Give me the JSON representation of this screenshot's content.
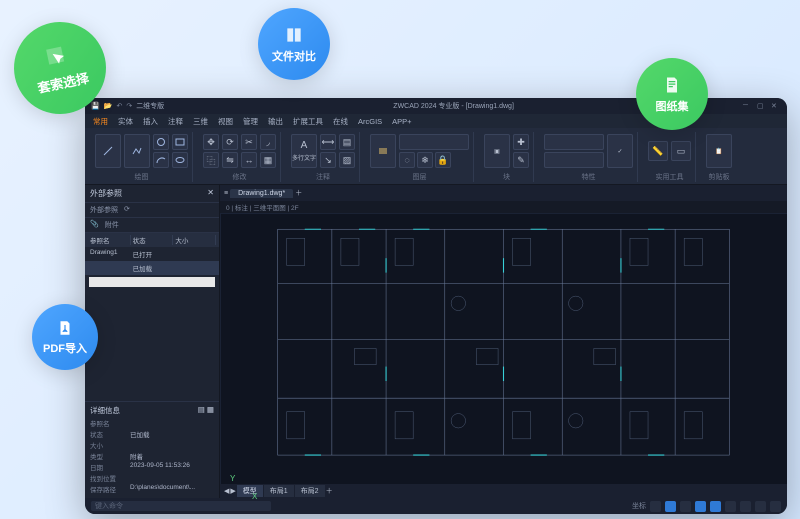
{
  "badges": {
    "lasso": "套索选择",
    "compare": "文件对比",
    "sheetset": "图纸集",
    "pdf": "PDF导入"
  },
  "titlebar": {
    "product": "二维专版",
    "title": "ZWCAD 2024 专业版 - [Drawing1.dwg]"
  },
  "menu": [
    "常用",
    "实体",
    "插入",
    "注释",
    "三维",
    "视图",
    "管理",
    "输出",
    "扩展工具",
    "在线",
    "ArcGIS",
    "APP+"
  ],
  "ribbon": {
    "groups": [
      {
        "label": "绘图"
      },
      {
        "label": "修改"
      },
      {
        "label": "注释"
      },
      {
        "label": "图层"
      },
      {
        "label": "块"
      },
      {
        "label": "特性"
      },
      {
        "label": "实用工具"
      },
      {
        "label": "剪贴板"
      }
    ],
    "annotate_btn": "多行文字"
  },
  "side": {
    "panel_title": "外部参照",
    "subtabs": [
      "外部参照",
      "附件"
    ],
    "cols": [
      "参照名",
      "状态",
      "大小"
    ],
    "rows": [
      {
        "name": "Drawing1",
        "status": "已打开",
        "size": ""
      },
      {
        "name": "",
        "status": "已加载",
        "size": ""
      }
    ],
    "detail_title": "详细信息",
    "details": [
      {
        "k": "参照名",
        "v": ""
      },
      {
        "k": "状态",
        "v": "已加载"
      },
      {
        "k": "大小",
        "v": ""
      },
      {
        "k": "类型",
        "v": "附着"
      },
      {
        "k": "日期",
        "v": "2023-09-05 11:53:26"
      },
      {
        "k": "找到位置",
        "v": ""
      },
      {
        "k": "保存路径",
        "v": "D:\\planes\\document\\..."
      }
    ]
  },
  "doc_tab": "Drawing1.dwg*",
  "layer_info": "0 | 标注 | 三维平面图 | 2F",
  "model_tabs": [
    "模型",
    "布局1",
    "布局2"
  ],
  "status": {
    "command_hint": "键入命令",
    "coords": "坐标"
  },
  "ucs": {
    "x": "X",
    "y": "Y"
  }
}
